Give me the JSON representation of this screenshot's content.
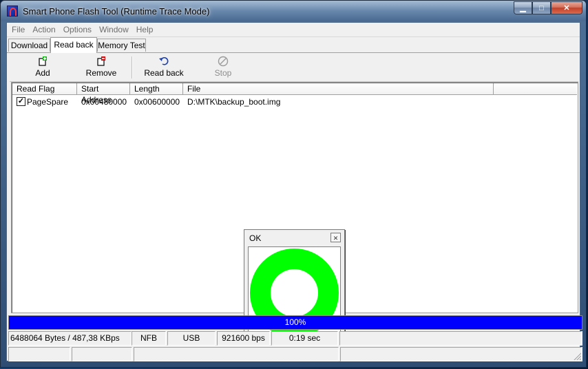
{
  "window": {
    "title": "Smart Phone Flash Tool (Runtime Trace Mode)",
    "controls": {
      "minimize": "▁",
      "maximize": "□",
      "close": "✕"
    }
  },
  "menu": [
    "File",
    "Action",
    "Options",
    "Window",
    "Help"
  ],
  "tabs": [
    {
      "label": "Download",
      "active": false
    },
    {
      "label": "Read back",
      "active": true
    },
    {
      "label": "Memory Test",
      "active": false
    }
  ],
  "toolbar": {
    "add": {
      "label": "Add",
      "icon": "add-icon"
    },
    "remove": {
      "label": "Remove",
      "icon": "remove-icon"
    },
    "readback": {
      "label": "Read back",
      "icon": "read-back-icon"
    },
    "stop": {
      "label": "Stop",
      "icon": "stop-icon",
      "disabled": true
    }
  },
  "list": {
    "columns": [
      "Read Flag",
      "Start Address",
      "Length",
      "File"
    ],
    "rows": [
      {
        "checked": true,
        "read_flag": "PageSpare",
        "start_address": "0x00480000",
        "length": "0x00600000",
        "file": "D:\\MTK\\backup_boot.img"
      }
    ]
  },
  "dialog": {
    "title": "OK",
    "close": "✕",
    "ring_color": "#00ff00"
  },
  "progress": {
    "percent": 100,
    "text": "100%",
    "color": "#0000ff"
  },
  "status": {
    "bytes": "6488064 Bytes / 487,38 KBps",
    "storage": "NFB",
    "connection": "USB",
    "baud": "921600 bps",
    "time": "0:19 sec"
  }
}
